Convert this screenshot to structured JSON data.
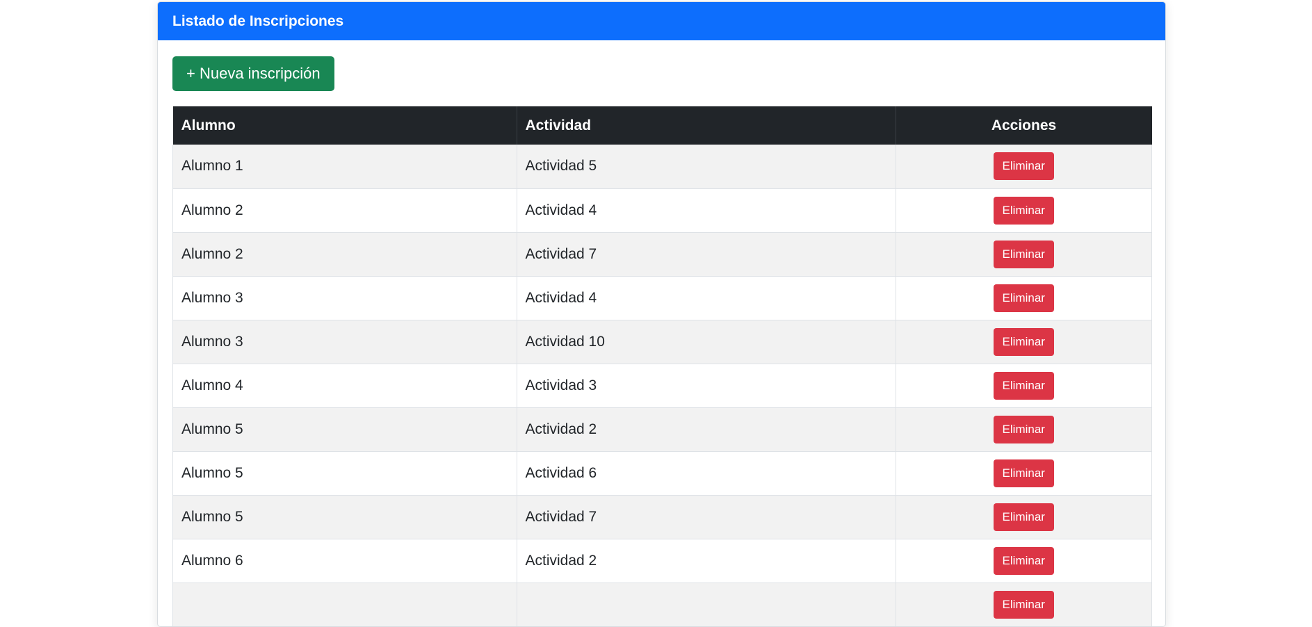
{
  "card": {
    "title": "Listado de Inscripciones",
    "new_button": "+ Nueva inscripción"
  },
  "table": {
    "headers": [
      "Alumno",
      "Actividad",
      "Acciones"
    ],
    "rows": [
      {
        "alumno": "Alumno 1",
        "actividad": "Actividad 5",
        "action": "Eliminar"
      },
      {
        "alumno": "Alumno 2",
        "actividad": "Actividad 4",
        "action": "Eliminar"
      },
      {
        "alumno": "Alumno 2",
        "actividad": "Actividad 7",
        "action": "Eliminar"
      },
      {
        "alumno": "Alumno 3",
        "actividad": "Actividad 4",
        "action": "Eliminar"
      },
      {
        "alumno": "Alumno 3",
        "actividad": "Actividad 10",
        "action": "Eliminar"
      },
      {
        "alumno": "Alumno 4",
        "actividad": "Actividad 3",
        "action": "Eliminar"
      },
      {
        "alumno": "Alumno 5",
        "actividad": "Actividad 2",
        "action": "Eliminar"
      },
      {
        "alumno": "Alumno 5",
        "actividad": "Actividad 6",
        "action": "Eliminar"
      },
      {
        "alumno": "Alumno 5",
        "actividad": "Actividad 7",
        "action": "Eliminar"
      },
      {
        "alumno": "Alumno 6",
        "actividad": "Actividad 2",
        "action": "Eliminar"
      }
    ]
  },
  "colors": {
    "header": "#0d6efd",
    "new_button": "#198754",
    "delete_button": "#dc3545",
    "table_head": "#212529"
  }
}
